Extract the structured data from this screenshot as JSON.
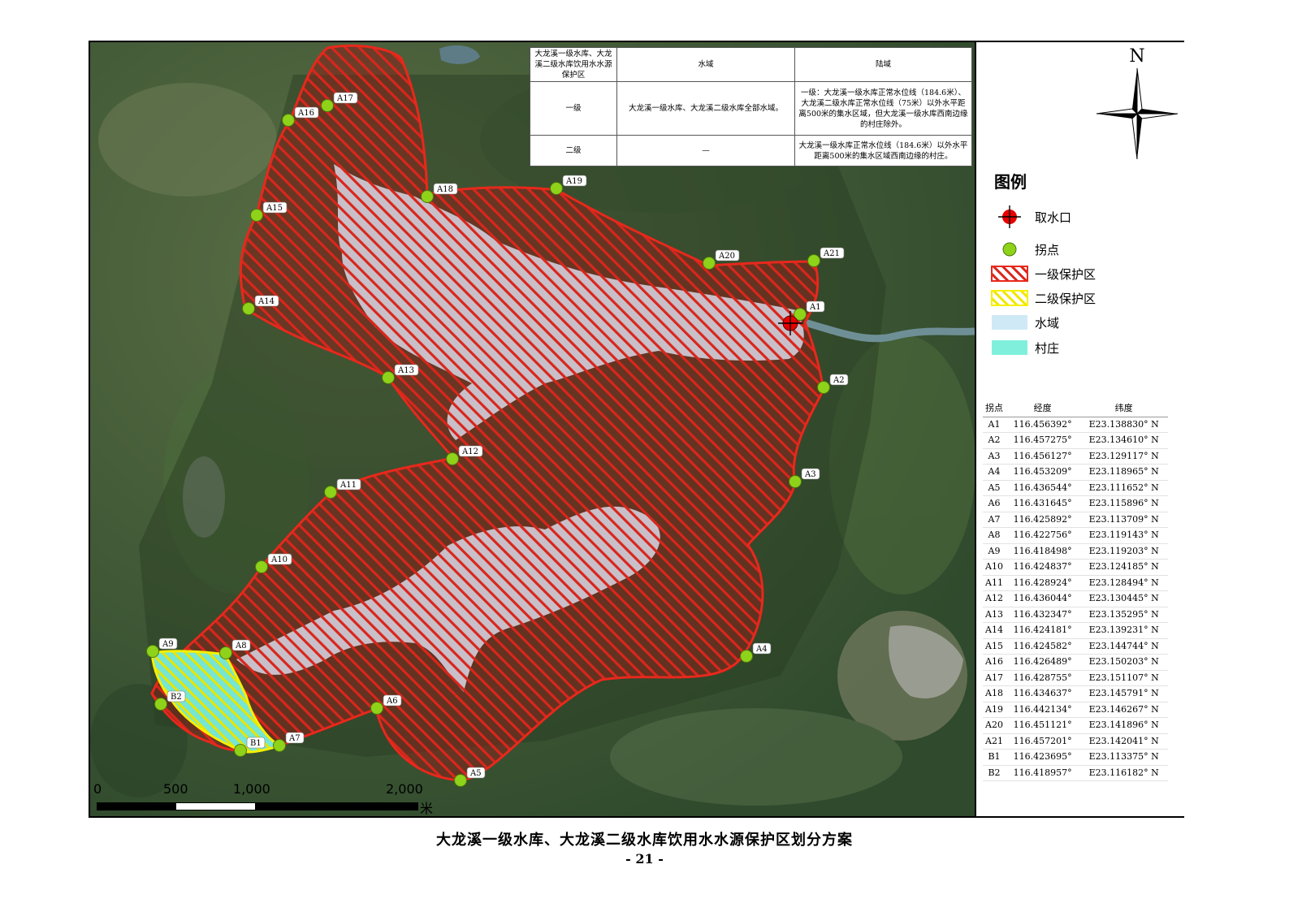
{
  "map": {
    "points": [
      {
        "id": "A1"
      },
      {
        "id": "A2"
      },
      {
        "id": "A3"
      },
      {
        "id": "A4"
      },
      {
        "id": "A5"
      },
      {
        "id": "A6"
      },
      {
        "id": "A7"
      },
      {
        "id": "A8"
      },
      {
        "id": "A9"
      },
      {
        "id": "A10"
      },
      {
        "id": "A11"
      },
      {
        "id": "A12"
      },
      {
        "id": "A13"
      },
      {
        "id": "A14"
      },
      {
        "id": "A15"
      },
      {
        "id": "A16"
      },
      {
        "id": "A17"
      },
      {
        "id": "A18"
      },
      {
        "id": "A19"
      },
      {
        "id": "A20"
      },
      {
        "id": "A21"
      },
      {
        "id": "B1"
      },
      {
        "id": "B2"
      }
    ],
    "colors": {
      "level1_outline": "#e8281c",
      "level1_hatch": "#d9261c",
      "level2_outline": "#f5f000",
      "water": "#c9bfc9",
      "village": "#77e6d2",
      "point": "#8ed21a",
      "intake": "#e80000"
    }
  },
  "zone_table": {
    "header": {
      "name": "大龙溪一级水库、大龙溪二级水库饮用水水源保护区",
      "water": "水域",
      "land": "陆域"
    },
    "rows": [
      {
        "level": "一级",
        "water": "大龙溪一级水库、大龙溪二级水库全部水域。",
        "land": "一级：大龙溪一级水库正常水位线（184.6米）、大龙溪二级水库正常水位线（75米）以外水平距离500米的集水区域，但大龙溪一级水库西南边缘的村庄除外。"
      },
      {
        "level": "二级",
        "water": "—",
        "land": "大龙溪一级水库正常水位线（184.6米）以外水平距离500米的集水区域西南边缘的村庄。"
      }
    ]
  },
  "legend": {
    "title": "图例",
    "items": [
      {
        "label": "取水口",
        "icon": "intake-icon"
      },
      {
        "label": "拐点",
        "icon": "point-icon"
      },
      {
        "label": "一级保护区",
        "icon": "red-hatch-swatch"
      },
      {
        "label": "二级保护区",
        "icon": "yellow-hatch-swatch"
      },
      {
        "label": "水域",
        "icon": "water-swatch"
      },
      {
        "label": "村庄",
        "icon": "village-swatch"
      }
    ]
  },
  "north_label": "N",
  "coord_table": {
    "headers": [
      "拐点",
      "经度",
      "纬度"
    ],
    "rows": [
      {
        "id": "A1",
        "lon": "116.456392°",
        "lat": "E23.138830° N"
      },
      {
        "id": "A2",
        "lon": "116.457275°",
        "lat": "E23.134610° N"
      },
      {
        "id": "A3",
        "lon": "116.456127°",
        "lat": "E23.129117° N"
      },
      {
        "id": "A4",
        "lon": "116.453209°",
        "lat": "E23.118965° N"
      },
      {
        "id": "A5",
        "lon": "116.436544°",
        "lat": "E23.111652° N"
      },
      {
        "id": "A6",
        "lon": "116.431645°",
        "lat": "E23.115896° N"
      },
      {
        "id": "A7",
        "lon": "116.425892°",
        "lat": "E23.113709° N"
      },
      {
        "id": "A8",
        "lon": "116.422756°",
        "lat": "E23.119143° N"
      },
      {
        "id": "A9",
        "lon": "116.418498°",
        "lat": "E23.119203° N"
      },
      {
        "id": "A10",
        "lon": "116.424837°",
        "lat": "E23.124185° N"
      },
      {
        "id": "A11",
        "lon": "116.428924°",
        "lat": "E23.128494° N"
      },
      {
        "id": "A12",
        "lon": "116.436044°",
        "lat": "E23.130445° N"
      },
      {
        "id": "A13",
        "lon": "116.432347°",
        "lat": "E23.135295° N"
      },
      {
        "id": "A14",
        "lon": "116.424181°",
        "lat": "E23.139231° N"
      },
      {
        "id": "A15",
        "lon": "116.424582°",
        "lat": "E23.144744° N"
      },
      {
        "id": "A16",
        "lon": "116.426489°",
        "lat": "E23.150203° N"
      },
      {
        "id": "A17",
        "lon": "116.428755°",
        "lat": "E23.151107° N"
      },
      {
        "id": "A18",
        "lon": "116.434637°",
        "lat": "E23.145791° N"
      },
      {
        "id": "A19",
        "lon": "116.442134°",
        "lat": "E23.146267° N"
      },
      {
        "id": "A20",
        "lon": "116.451121°",
        "lat": "E23.141896° N"
      },
      {
        "id": "A21",
        "lon": "116.457201°",
        "lat": "E23.142041° N"
      },
      {
        "id": "B1",
        "lon": "116.423695°",
        "lat": "E23.113375° N"
      },
      {
        "id": "B2",
        "lon": "116.418957°",
        "lat": "E23.116182° N"
      }
    ]
  },
  "scale": {
    "ticks": [
      "0",
      "500",
      "1,000",
      "2,000"
    ],
    "unit": "米"
  },
  "caption": "大龙溪一级水库、大龙溪二级水库饮用水水源保护区划分方案",
  "page_number": "- 21 -"
}
